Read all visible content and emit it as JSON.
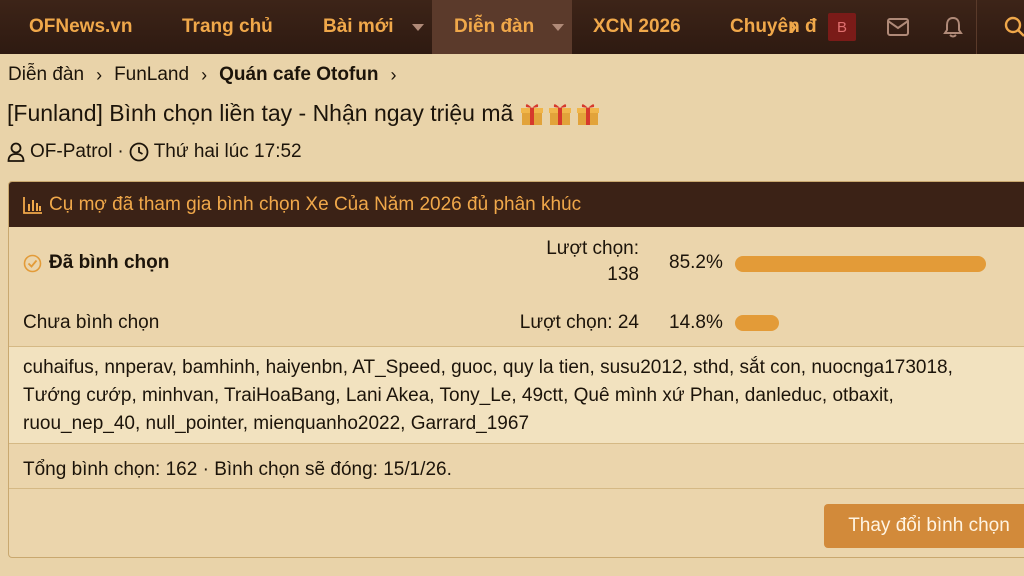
{
  "nav": {
    "logo": "OFNews.vn",
    "home": "Trang chủ",
    "new_posts": "Bài mới",
    "forum": "Diễn đàn",
    "xcn": "XCN 2026",
    "topic": "Chuyên đ",
    "badge": "B",
    "icons": [
      "chevron-right-icon",
      "mail-icon",
      "bell-icon",
      "search-icon"
    ]
  },
  "breadcrumb": [
    "Diễn đàn",
    "FunLand",
    "Quán cafe Otofun"
  ],
  "thread": {
    "title": "[Funland] Bình chọn liền tay - Nhận ngay triệu mã",
    "author": "OF-Patrol",
    "separator": "·",
    "time": "Thứ hai lúc 17:52"
  },
  "poll": {
    "question": "Cụ mợ đã tham gia bình chọn Xe Của Năm 2026 đủ phân khúc",
    "options": [
      {
        "label": "Đã bình chọn",
        "votes_label": "Lượt chọn:",
        "votes": "138",
        "percent_text": "85.2%",
        "percent": 85.2,
        "selected": true
      },
      {
        "label": "Chưa bình chọn",
        "votes_label": "Lượt chọn:",
        "votes": "24",
        "percent_text": "14.8%",
        "percent": 14.8,
        "selected": false
      }
    ],
    "voters_lines": [
      "cuhaifus, nnperav, bamhinh, haiyenbn, AT_Speed, guoc, quy la tien, susu2012, sthd, sắt con, nuocnga173018,",
      "Tướng cướp, minhvan, TraiHoaBang, Lani Akea, Tony_Le, 49ctt, Quê mình xứ Phan, danleduc, otbaxit,",
      "ruou_nep_40, null_pointer, mienquanho2022, Garrard_1967"
    ],
    "summary": "Tổng bình chọn: 162 · Bình chọn sẽ đóng: 15/1/26.",
    "change_button": "Thay đổi bình chọn"
  },
  "colors": {
    "accent": "#f0a84a",
    "bar": "#e39b38",
    "header_bg": "#3b2216",
    "page_bg": "#e9d3a9"
  }
}
